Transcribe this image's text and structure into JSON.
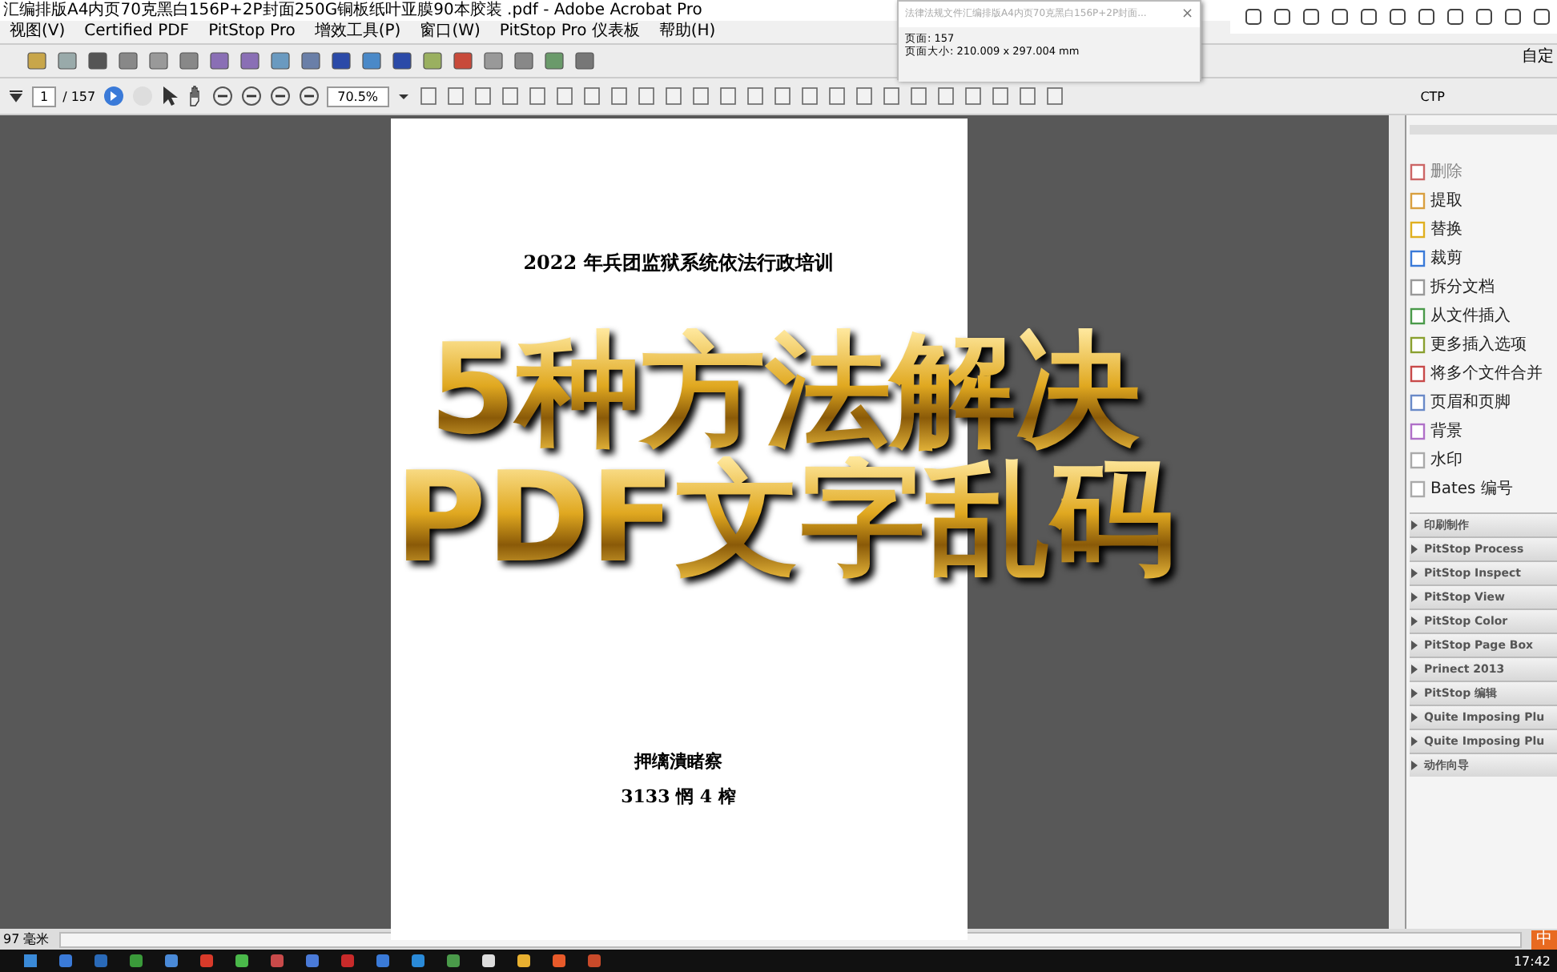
{
  "window": {
    "title": "汇编排版A4内页70克黑白156P+2P封面250G铜板纸叶亚膜90本胶装 .pdf - Adobe Acrobat Pro"
  },
  "menu": [
    "视图(V)",
    "Certified PDF",
    "PitStop Pro",
    "增效工具(P)",
    "窗口(W)",
    "PitStop Pro 仪表板",
    "帮助(H)"
  ],
  "navigation": {
    "page": "1",
    "page_count": "/ 157",
    "zoom": "70.5%"
  },
  "toolbar_label": "CTP",
  "customize_label": "自定",
  "tooltip": {
    "close": "×",
    "title": "法律法规文件汇编排版A4内页70克黑白156P+2P封面...",
    "pages": "页面: 157",
    "size": "页面大小: 210.009 x 297.004 mm"
  },
  "document": {
    "heading": "2022 年兵团监狱系统依法行政培训",
    "footer_line_1": "押缡潰睹察",
    "footer_line_2": "3133 惘 4 榨"
  },
  "overlay_title": [
    "5种方法解决",
    "PDF文字乱码"
  ],
  "panel": {
    "items": [
      {
        "label": "删除",
        "disabled": true
      },
      {
        "label": "提取",
        "disabled": false
      },
      {
        "label": "替换",
        "disabled": false
      },
      {
        "label": "裁剪",
        "disabled": false
      },
      {
        "label": "拆分文档",
        "disabled": false
      },
      {
        "label": "从文件插入",
        "disabled": false
      },
      {
        "label": "更多插入选项",
        "disabled": false
      },
      {
        "label": "将多个文件合并",
        "disabled": false
      },
      {
        "label": "页眉和页脚",
        "disabled": false
      },
      {
        "label": "背景",
        "disabled": false
      },
      {
        "label": "水印",
        "disabled": false
      },
      {
        "label": "Bates 编号",
        "disabled": false
      }
    ],
    "groups": [
      {
        "label": "印刷制作",
        "expanded": false
      },
      {
        "label": "PitStop Process",
        "expanded": false
      },
      {
        "label": "PitStop Inspect",
        "expanded": false
      },
      {
        "label": "PitStop View",
        "expanded": false
      },
      {
        "label": "PitStop Color",
        "expanded": false
      },
      {
        "label": "PitStop Page Box",
        "expanded": false
      },
      {
        "label": "Prinect 2013",
        "expanded": false
      },
      {
        "label": "PitStop 编辑",
        "expanded": false
      },
      {
        "label": "Quite Imposing Plu",
        "expanded": false
      },
      {
        "label": "Quite Imposing Plu",
        "expanded": false
      },
      {
        "label": "动作向导",
        "expanded": false
      }
    ]
  },
  "status_bar": {
    "measure": "97 毫米"
  },
  "taskbar": {
    "ime": "中",
    "clock": "17:42"
  }
}
